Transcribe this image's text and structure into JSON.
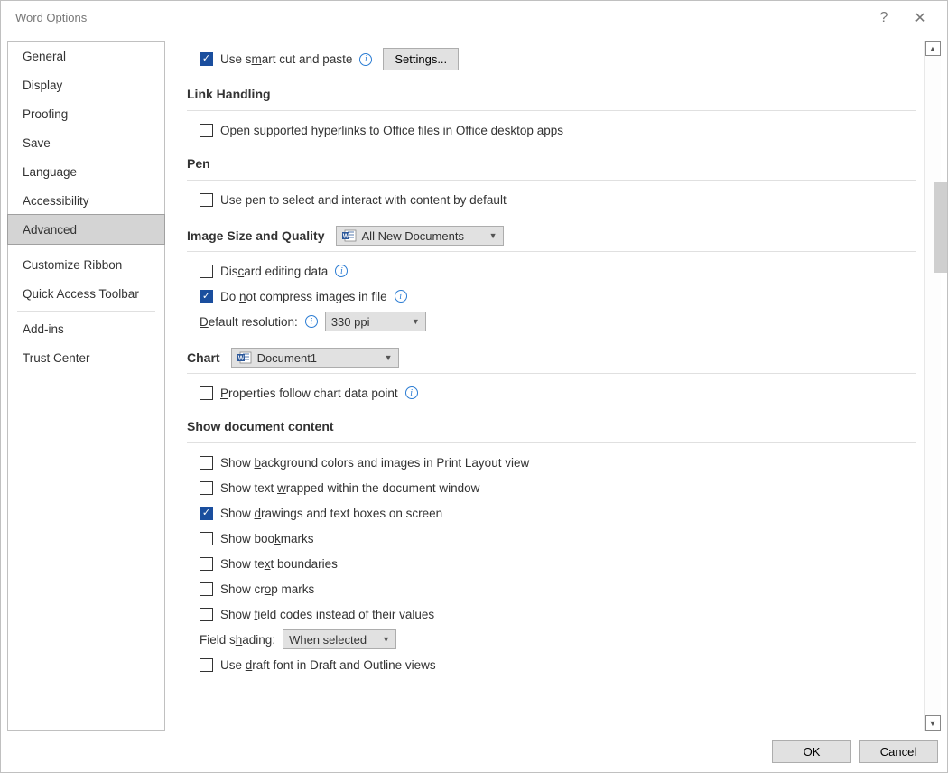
{
  "window": {
    "title": "Word Options"
  },
  "sidebar": {
    "items": [
      {
        "label": "General"
      },
      {
        "label": "Display"
      },
      {
        "label": "Proofing"
      },
      {
        "label": "Save"
      },
      {
        "label": "Language"
      },
      {
        "label": "Accessibility"
      },
      {
        "label": "Advanced",
        "selected": true
      }
    ],
    "items2": [
      {
        "label": "Customize Ribbon"
      },
      {
        "label": "Quick Access Toolbar"
      }
    ],
    "items3": [
      {
        "label": "Add-ins"
      },
      {
        "label": "Trust Center"
      }
    ]
  },
  "content": {
    "smart_cut_paste": {
      "checked": true,
      "label_pre": "Use s",
      "label_ul": "m",
      "label_post": "art cut and paste",
      "settings_btn": "Settings..."
    },
    "link_handling": {
      "title": "Link Handling",
      "open_hyperlinks": {
        "checked": false,
        "label": "Open supported hyperlinks to Office files in Office desktop apps"
      }
    },
    "pen": {
      "title": "Pen",
      "use_pen": {
        "checked": false,
        "label": "Use pen to select and interact with content by default"
      }
    },
    "image_quality": {
      "title_pre": "Image ",
      "title_ul": "S",
      "title_post": "ize and Quality",
      "scope": "All New Documents",
      "discard": {
        "checked": false,
        "pre": "Dis",
        "ul": "c",
        "post": "ard editing data"
      },
      "no_compress": {
        "checked": true,
        "pre": "Do ",
        "ul": "n",
        "post": "ot compress images in file"
      },
      "res_label_pre": "",
      "res_label_ul": "D",
      "res_label_post": "efault resolution:",
      "res_value": "330 ppi"
    },
    "chart": {
      "title": "Chart",
      "scope": "Document1",
      "props": {
        "checked": false,
        "pre": "",
        "ul": "P",
        "post": "roperties follow chart data point"
      }
    },
    "show_content": {
      "title": "Show document content",
      "bg": {
        "checked": false,
        "pre": "Show ",
        "ul": "b",
        "post": "ackground colors and images in Print Layout view"
      },
      "wrap": {
        "checked": false,
        "pre": "Show text ",
        "ul": "w",
        "post": "rapped within the document window"
      },
      "draw": {
        "checked": true,
        "pre": "Show ",
        "ul": "d",
        "post": "rawings and text boxes on screen"
      },
      "bookmarks": {
        "checked": false,
        "pre": "Show boo",
        "ul": "k",
        "post": "marks"
      },
      "bound": {
        "checked": false,
        "pre": "Show te",
        "ul": "x",
        "post": "t boundaries"
      },
      "crop": {
        "checked": false,
        "pre": "Show cr",
        "ul": "o",
        "post": "p marks"
      },
      "field": {
        "checked": false,
        "pre": "Show ",
        "ul": "f",
        "post": "ield codes instead of their values"
      },
      "shading_label_pre": "Field s",
      "shading_label_ul": "h",
      "shading_label_post": "ading:",
      "shading_value": "When selected",
      "draft": {
        "checked": false,
        "pre": "Use ",
        "ul": "d",
        "post": "raft font in Draft and Outline views"
      }
    }
  },
  "footer": {
    "ok": "OK",
    "cancel": "Cancel"
  }
}
